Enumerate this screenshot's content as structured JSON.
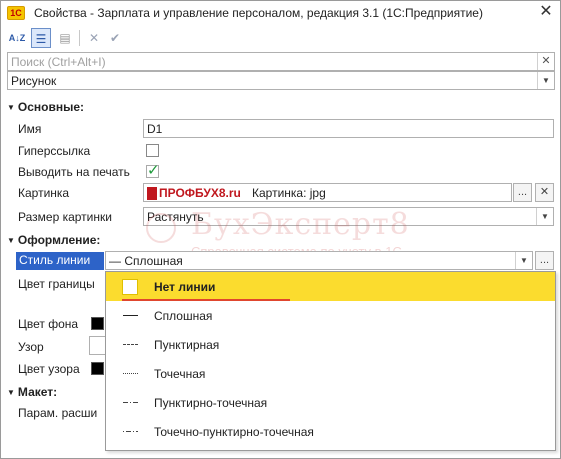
{
  "window": {
    "app_icon_text": "1С",
    "title": "Свойства - Зарплата и управление персоналом, редакция 3.1  (1С:Предприятие)",
    "close_glyph": "✕"
  },
  "toolbar": {
    "sort_glyph": "A↓Z",
    "categories_glyph": "☰",
    "other_glyph": "▤",
    "cancel_glyph": "✕",
    "apply_glyph": "✔"
  },
  "search": {
    "placeholder": "Поиск (Ctrl+Alt+I)",
    "clear_glyph": "✕"
  },
  "object_selector": {
    "value": "Рисунок",
    "drop_glyph": "▼"
  },
  "groups": {
    "main": "Основные:",
    "design": "Оформление:",
    "layout": "Макет:"
  },
  "props": {
    "name_label": "Имя",
    "name_value": "D1",
    "hyperlink_label": "Гиперссылка",
    "print_label": "Выводить на печать",
    "print_checked": "✓",
    "picture_label": "Картинка",
    "picture_logo": "ПРОФБУХ8.ru",
    "picture_value": "Картинка: jpg",
    "picture_dots": "...",
    "picture_clear": "✕",
    "size_label": "Размер картинки",
    "size_value": "Растянуть",
    "line_style_label": "Стиль линии",
    "line_style_value": "— Сплошная",
    "line_style_dots": "...",
    "border_color_label": "Цвет границы",
    "bg_color_label": "Цвет фона",
    "pattern_label": "Узор",
    "pattern_color_label": "Цвет узора",
    "ext_params_label": "Парам. расши"
  },
  "watermark": {
    "title": "БухЭксперт8",
    "subtitle": "Справочная система по учету в 1С"
  },
  "dropdown": {
    "items": [
      {
        "label": "Нет линии",
        "style": "none"
      },
      {
        "label": "Сплошная",
        "style": "solid"
      },
      {
        "label": "Пунктирная",
        "style": "dashed"
      },
      {
        "label": "Точечная",
        "style": "dotted"
      },
      {
        "label": "Пунктирно-точечная",
        "style": "dash-dot"
      },
      {
        "label": "Точечно-пунктирно-точечная",
        "style": "dot-dash-dot"
      }
    ],
    "selected_index": 0
  },
  "colors": {
    "selection": "#fbdc2e",
    "active_label": "#2d63c8",
    "check": "#1f9a3c",
    "logo": "#c0171e"
  }
}
